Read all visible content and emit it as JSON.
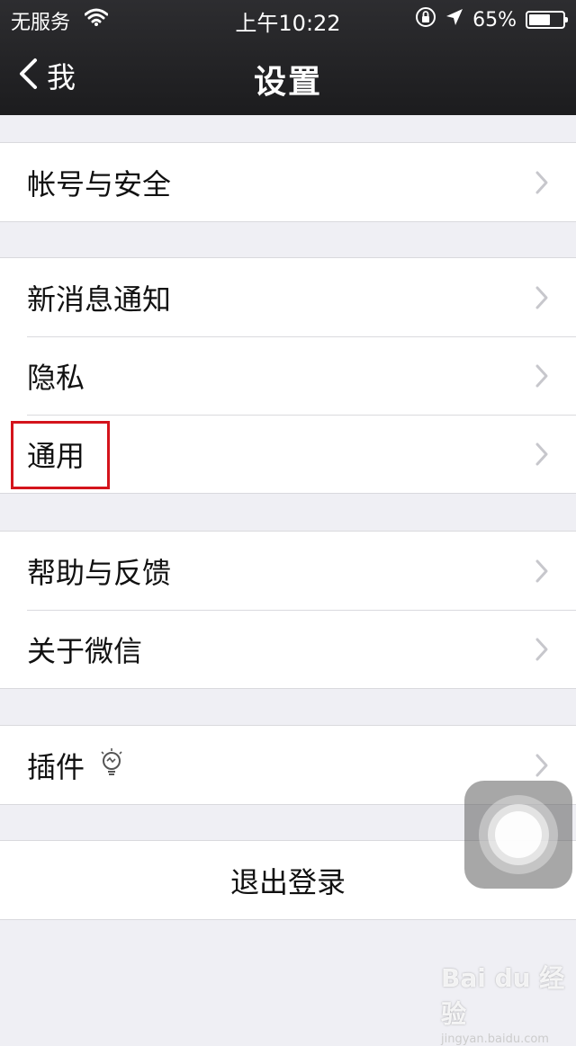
{
  "status_bar": {
    "carrier": "无服务",
    "time": "上午10:22",
    "battery": "65%",
    "battery_level": 0.65
  },
  "nav": {
    "back_label": "我",
    "title": "设置"
  },
  "groups": [
    {
      "items": [
        {
          "label": "帐号与安全"
        }
      ]
    },
    {
      "items": [
        {
          "label": "新消息通知"
        },
        {
          "label": "隐私"
        },
        {
          "label": "通用"
        }
      ]
    },
    {
      "items": [
        {
          "label": "帮助与反馈"
        },
        {
          "label": "关于微信"
        }
      ]
    },
    {
      "items": [
        {
          "label": "插件",
          "icon": "lightbulb-icon"
        }
      ]
    },
    {
      "items": [
        {
          "label": "退出登录"
        }
      ]
    }
  ],
  "colors": {
    "nav_bg": "#1c1c1e",
    "page_bg": "#efeff4",
    "chevron": "#c7c7cc",
    "highlight_box": "#d4141c"
  },
  "watermark": {
    "brand": "Bai du 经验",
    "url": "jingyan.baidu.com"
  }
}
